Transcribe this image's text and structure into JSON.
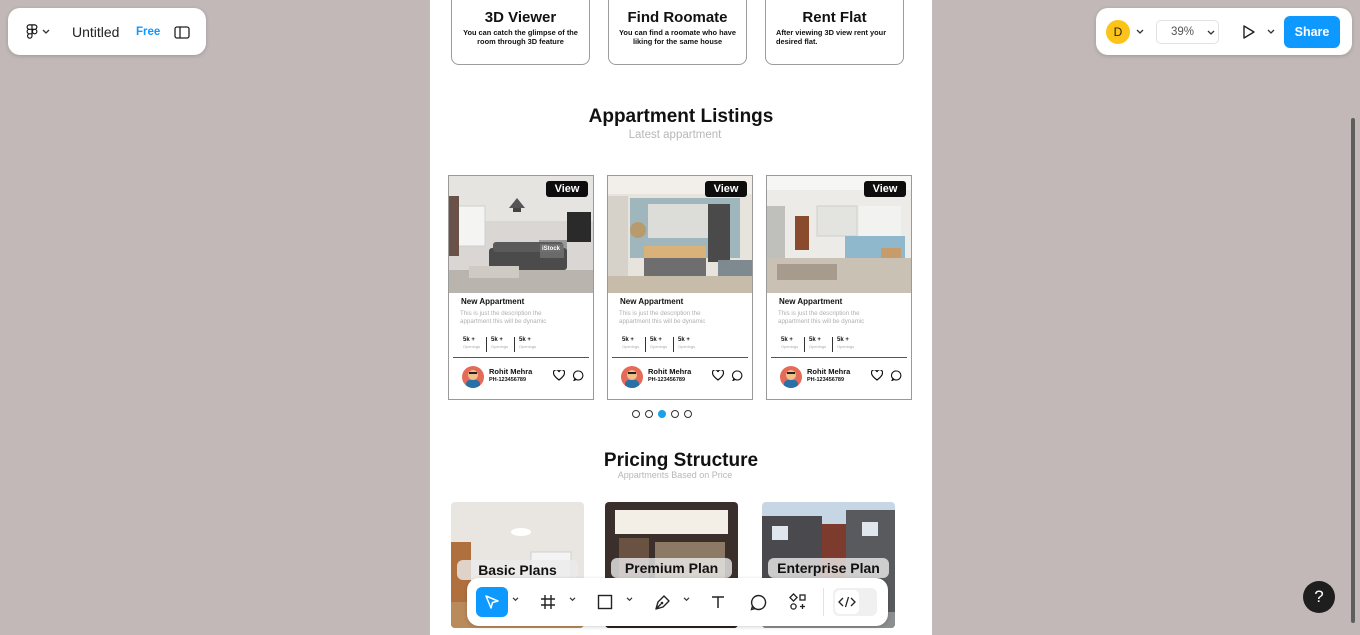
{
  "file_bar": {
    "title": "Untitled",
    "plan_badge": "Free"
  },
  "top_right": {
    "avatar_letter": "D",
    "zoom": "39%",
    "share_label": "Share"
  },
  "features": [
    {
      "title": "3D Viewer",
      "desc": "You can catch the glimpse of the room through 3D feature"
    },
    {
      "title": "Find Roomate",
      "desc": "You can find a roomate who have liking for the same house"
    },
    {
      "title": "Rent Flat",
      "desc": "After viewing 3D view rent your desired flat."
    }
  ],
  "listings_section": {
    "title": "Appartment Listings",
    "subtitle": "Latest appartment"
  },
  "listings": [
    {
      "view_label": "View",
      "title": "New Appartment",
      "desc": "This is just the description the appartment this will be dynamic",
      "stats": [
        {
          "value": "5k +",
          "label": "Openings"
        },
        {
          "value": "5k +",
          "label": "Openings"
        },
        {
          "value": "5k +",
          "label": "Openings"
        }
      ],
      "agent_name": "Rohit Mehra",
      "agent_phone": "PH-123456789",
      "watermark": "iStock"
    },
    {
      "view_label": "View",
      "title": "New Appartment",
      "desc": "This is just the description the appartment this will be dynamic",
      "stats": [
        {
          "value": "5k +",
          "label": "Openings"
        },
        {
          "value": "5k +",
          "label": "Openings"
        },
        {
          "value": "5k +",
          "label": "Openings"
        }
      ],
      "agent_name": "Rohit Mehra",
      "agent_phone": "PH-123456789"
    },
    {
      "view_label": "View",
      "title": "New Appartment",
      "desc": "This is just the description the appartment this will be dynamic",
      "stats": [
        {
          "value": "5k +",
          "label": "Openings"
        },
        {
          "value": "5k +",
          "label": "Openings"
        },
        {
          "value": "5k +",
          "label": "Openings"
        }
      ],
      "agent_name": "Rohit Mehra",
      "agent_phone": "PH-123456789"
    }
  ],
  "carousel": {
    "total": 5,
    "active_index": 2
  },
  "pricing_section": {
    "title": "Pricing Structure",
    "subtitle": "Appartments Based on Price"
  },
  "plans": [
    {
      "label": "Basic Plans"
    },
    {
      "label": "Premium Plan"
    },
    {
      "label": "Enterprise Plan"
    }
  ],
  "toolbar_tools": [
    "move-tool",
    "frame-tool",
    "shape-tool",
    "pen-tool",
    "text-tool",
    "comment-tool",
    "actions-tool",
    "dev-mode-toggle"
  ],
  "help_label": "?",
  "colors": {
    "accent": "#0d99ff",
    "canvas_bg": "#c3b8b8",
    "active_dot": "#18a0e8"
  }
}
